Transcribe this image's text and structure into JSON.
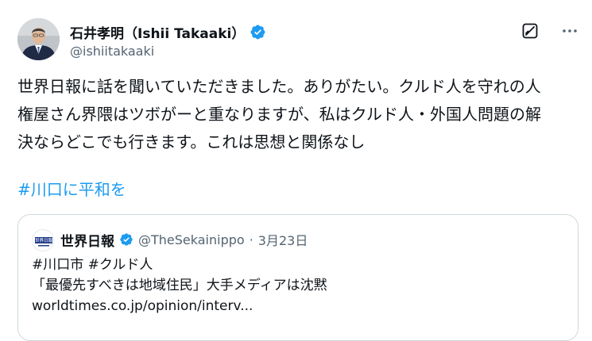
{
  "author": {
    "name": "石井孝明（Ishii Takaaki）",
    "handle": "@ishiitakaaki",
    "verified_color": "#1d9bf0"
  },
  "icons": {
    "grok": "grok-icon",
    "more": "more-icon",
    "verified": "verified-badge-icon"
  },
  "tweet": {
    "lines": [
      "世界日報に話を聞いていただきました。ありがたい。クルド人を守れの人",
      "権屋さん界隈はツボがーと重なりますが、私はクルド人・外国人問題の解",
      "決ならどこでも行きます。これは思想と関係なし"
    ],
    "hashtag": "#川口に平和を"
  },
  "quote": {
    "avatar_text": "世界日報",
    "name": "世界日報",
    "handle": "@TheSekainippo",
    "separator": "·",
    "date": "3月23日",
    "lines": [
      "#川口市 #クルド人",
      "「最優先すべきは地域住民」大手メディアは沈黙",
      "worldtimes.co.jp/opinion/interv..."
    ]
  },
  "colors": {
    "text": "#0f1419",
    "secondary": "#536471",
    "link": "#1d9bf0",
    "border": "#cfd9de"
  }
}
